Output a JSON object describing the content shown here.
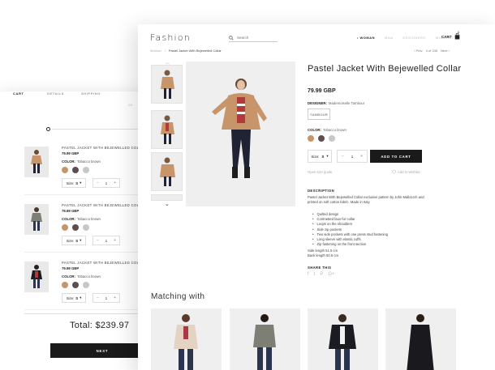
{
  "cart": {
    "ghost_text": "Ch",
    "steps": [
      "CART",
      "DETAILS",
      "SHIPPING"
    ],
    "items": [
      {
        "title": "PASTEL JACKET WITH BEJEWELLED COLLAR",
        "price": "79.99 GBP",
        "color_label": "COLOR:",
        "color_value": "Tobacco brown",
        "size_label": "Size:",
        "size_value": "S",
        "qty": "1"
      },
      {
        "title": "PASTEL JACKET WITH BEJEWELLED COLLAR",
        "price": "79.99 GBP",
        "color_label": "COLOR:",
        "color_value": "Tobacco brown",
        "size_label": "Size:",
        "size_value": "S",
        "qty": "1"
      },
      {
        "title": "PASTEL JACKET WITH BEJEWELLED COLLAR",
        "price": "79.99 GBP",
        "color_label": "COLOR:",
        "color_value": "Tobacco brown",
        "size_label": "Size:",
        "size_value": "S",
        "qty": "1"
      }
    ],
    "total": "Total: $239.97",
    "next_label": "NEXT"
  },
  "header": {
    "brand": "Fashion",
    "search_placeholder": "Search",
    "nav": [
      "WOMAN",
      "MAN",
      "DESIGNERS",
      "WISHLIST"
    ],
    "cart_label": "CART",
    "cart_count": "1"
  },
  "breadcrumb": {
    "parent": "Woman",
    "separator": "/",
    "current": "Pastel Jacket With Bejewelled Collar"
  },
  "pager": {
    "prev": "‹ Prev",
    "position": "4 of 245",
    "next": "Next ›"
  },
  "product": {
    "title": "Pastel Jacket With Bejewelled Collar",
    "price": "79.99 GBP",
    "designer_label": "DESIGNER:",
    "designer_value": "Mademoiselle Tambour",
    "designer_logo": "TAMBOUR",
    "color_label": "COLOR:",
    "color_value": "Tobacco brown",
    "size_label": "Size:",
    "size_value": "S",
    "qty": "1",
    "add_to_cart": "ADD TO CART",
    "size_guide": "Open size guide",
    "wishlist": "Add to Wishlist",
    "description_heading": "DESCRIPTION",
    "description": "Pastel Jacket With Bejewelled Collar exclusive pattern by John Mallocrch and printed on soft cotton fabric. Made in Italy.",
    "features": [
      "Quilted design",
      "Contrasted faux-fur collar",
      "Loops on the shoulders",
      "Side zip pockets",
      "Two side pockets with one press stud fastening",
      "Long sleeve with elastic cuffs",
      "Zip fastening on the front section"
    ],
    "side_length": "Side length 51.5 cm",
    "back_length": "Back length 50.5 cm",
    "share_heading": "SHARE THIS",
    "share_icons": [
      "f",
      "t",
      "P",
      "G+"
    ]
  },
  "colors": {
    "swatch_brown": "#c8956a",
    "swatch_dark": "#5e4f4f",
    "swatch_gray": "#c7c7c7",
    "button_dark": "#1a1a1a"
  },
  "matching": {
    "heading": "Matching with"
  }
}
